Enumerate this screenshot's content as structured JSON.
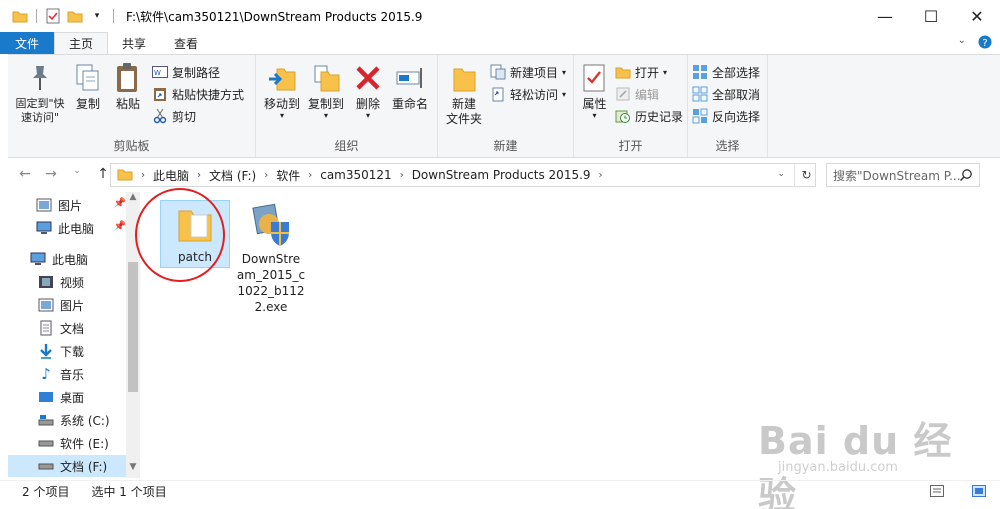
{
  "window": {
    "title": "F:\\软件\\cam350121\\DownStream Products 2015.9",
    "minimize": "—",
    "maximize": "☐",
    "close": "✕"
  },
  "tabs": [
    "文件",
    "主页",
    "共享",
    "查看"
  ],
  "ribbon": {
    "clipboard": {
      "label": "剪贴板",
      "pin": "固定到\"快\n速访问\"",
      "copy": "复制",
      "paste": "粘贴",
      "copy_path": "复制路径",
      "paste_shortcut": "粘贴快捷方式",
      "cut": "剪切"
    },
    "organize": {
      "label": "组织",
      "move_to": "移动到",
      "copy_to": "复制到",
      "delete": "删除",
      "rename": "重命名"
    },
    "new": {
      "label": "新建",
      "new_folder": "新建\n文件夹",
      "new_item": "新建项目",
      "easy_access": "轻松访问"
    },
    "open": {
      "label": "打开",
      "properties": "属性",
      "open": "打开",
      "edit": "编辑",
      "history": "历史记录"
    },
    "select": {
      "label": "选择",
      "select_all": "全部选择",
      "select_none": "全部取消",
      "invert": "反向选择"
    }
  },
  "address": {
    "crumbs": [
      "此电脑",
      "文档 (F:)",
      "软件",
      "cam350121",
      "DownStream Products 2015.9"
    ],
    "search_placeholder": "搜索\"DownStream P..."
  },
  "nav": {
    "items": [
      {
        "label": "图片",
        "icon": "pictures-icon",
        "pinned": true
      },
      {
        "label": "此电脑",
        "icon": "computer-icon",
        "pinned": true
      },
      {
        "label": "此电脑",
        "icon": "computer-icon"
      },
      {
        "label": "视频",
        "icon": "video-icon"
      },
      {
        "label": "图片",
        "icon": "pictures-icon"
      },
      {
        "label": "文档",
        "icon": "document-icon"
      },
      {
        "label": "下载",
        "icon": "download-icon"
      },
      {
        "label": "音乐",
        "icon": "music-icon"
      },
      {
        "label": "桌面",
        "icon": "desktop-icon"
      },
      {
        "label": "系统 (C:)",
        "icon": "drive-icon"
      },
      {
        "label": "软件 (E:)",
        "icon": "drive-icon"
      },
      {
        "label": "文档 (F:)",
        "icon": "drive-icon",
        "selected": true
      }
    ]
  },
  "files": [
    {
      "name": "patch",
      "type": "folder",
      "selected": true
    },
    {
      "name": "DownStream_2015_c1022_b1122.exe",
      "display": [
        "DownStre",
        "am_2015_c",
        "1022_b112",
        "2.exe"
      ],
      "type": "installer"
    }
  ],
  "status": {
    "count": "2 个项目",
    "selected": "选中 1 个项目"
  },
  "watermark": {
    "brand": "Bai du 经验",
    "url": "jingyan.baidu.com"
  },
  "colors": {
    "file_tab": "#1979ca",
    "selection": "#cce8ff",
    "highlight_circle": "#e02020",
    "folder": "#f8c24a"
  }
}
